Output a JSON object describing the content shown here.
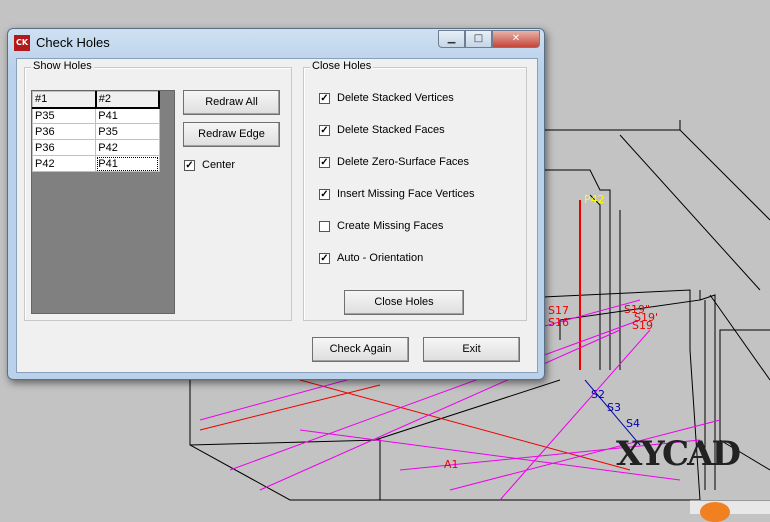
{
  "dialog": {
    "title": "Check Holes",
    "icon": "app-logo-icon"
  },
  "window_buttons": {
    "minimize": "minimize-icon",
    "maximize": "maximize-icon",
    "close": "close-icon"
  },
  "show_holes": {
    "title": "Show Holes",
    "columns": [
      "#1",
      "#2"
    ],
    "rows": [
      [
        "P35",
        "P41"
      ],
      [
        "P36",
        "P35"
      ],
      [
        "P36",
        "P42"
      ],
      [
        "P42",
        "P41"
      ]
    ],
    "redraw_all": "Redraw All",
    "redraw_edge": "Redraw Edge",
    "center": {
      "label": "Center",
      "checked": true
    }
  },
  "close_holes": {
    "title": "Close Holes",
    "options": [
      {
        "label": "Delete Stacked Vertices",
        "checked": true
      },
      {
        "label": "Delete Stacked Faces",
        "checked": true
      },
      {
        "label": "Delete Zero-Surface Faces",
        "checked": true
      },
      {
        "label": "Insert Missing Face Vertices",
        "checked": true
      },
      {
        "label": "Create Missing Faces",
        "checked": false
      },
      {
        "label": "Auto - Orientation",
        "checked": true
      }
    ],
    "button": "Close Holes"
  },
  "footer": {
    "check_again": "Check Again",
    "exit": "Exit"
  },
  "viewport": {
    "labels": {
      "p42": "P42",
      "s17": "S17",
      "s16": "S16",
      "s19a": "S19\"",
      "s19b": "S19'",
      "s19c": "S19",
      "s2": "S2",
      "s3": "S3",
      "s4": "S4",
      "a1": "A1"
    }
  },
  "watermark": "XYCAD"
}
